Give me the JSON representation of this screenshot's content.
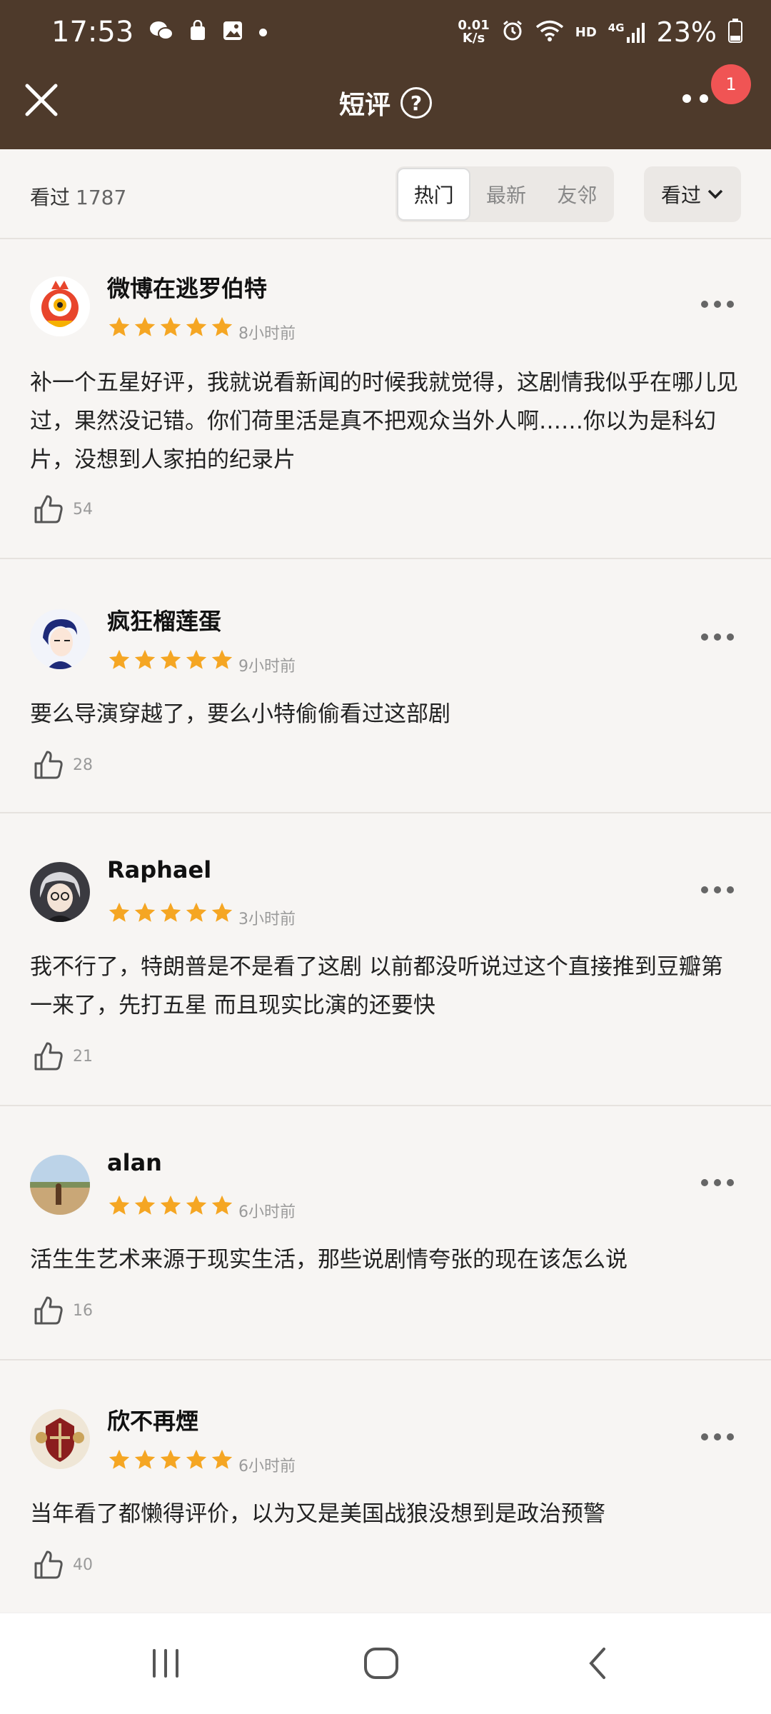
{
  "status_bar": {
    "time": "17:53",
    "net_speed_value": "0.01",
    "net_speed_unit": "K/s",
    "hd": "HD",
    "network": "4G",
    "battery": "23%"
  },
  "nav": {
    "title": "短评",
    "help": "?",
    "badge": "1"
  },
  "filter": {
    "watched_label": "看过",
    "watched_count": "1787",
    "tabs": [
      "热门",
      "最新",
      "友邻"
    ],
    "active_tab": "热门",
    "dropdown_label": "看过"
  },
  "reviews": [
    {
      "username": "微博在逃罗伯特",
      "rating": 5,
      "time": "8小时前",
      "content": "补一个五星好评，我就说看新闻的时候我就觉得，这剧情我似乎在哪儿见过，果然没记错。你们荷里活是真不把观众当外人啊……你以为是科幻片，没想到人家拍的纪录片",
      "likes": "54"
    },
    {
      "username": "疯狂榴莲蛋",
      "rating": 5,
      "time": "9小时前",
      "content": "要么导演穿越了，要么小特偷偷看过这部剧",
      "likes": "28"
    },
    {
      "username": "Raphael",
      "rating": 5,
      "time": "3小时前",
      "content": "我不行了，特朗普是不是看了这剧  以前都没听说过这个直接推到豆瓣第一来了，先打五星  而且现实比演的还要快",
      "likes": "21"
    },
    {
      "username": "alan",
      "rating": 5,
      "time": "6小时前",
      "content": "活生生艺术来源于现实生活，那些说剧情夸张的现在该怎么说",
      "likes": "16"
    },
    {
      "username": "欣不再煙",
      "rating": 5,
      "time": "6小时前",
      "content": "当年看了都懒得评价，以为又是美国战狼没想到是政治预警",
      "likes": "40"
    }
  ],
  "colors": {
    "header_bg": "#4e3a2b",
    "star": "#f5a623",
    "badge": "#f05454",
    "page_bg": "#f7f5f3"
  }
}
